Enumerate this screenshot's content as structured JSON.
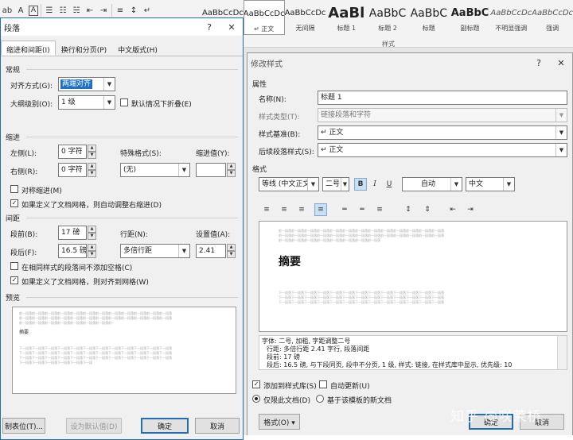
{
  "ribbon": {
    "styles": [
      {
        "preview": "AaBbCcDc",
        "name": "",
        "size": 10,
        "weight": "normal",
        "italic": false,
        "selected": false
      },
      {
        "preview": "AaBbCcDc",
        "name": "↵ 正文",
        "size": 10,
        "weight": "normal",
        "italic": false,
        "selected": true
      },
      {
        "preview": "AaBbCcDc",
        "name": "无间隔",
        "size": 10,
        "weight": "normal",
        "italic": false,
        "selected": false
      },
      {
        "preview": "AaBl",
        "name": "标题 1",
        "size": 18,
        "weight": "bold",
        "italic": false,
        "selected": false
      },
      {
        "preview": "AaBbC",
        "name": "标题 2",
        "size": 14,
        "weight": "normal",
        "italic": false,
        "selected": false
      },
      {
        "preview": "AaBbC",
        "name": "标题",
        "size": 14,
        "weight": "normal",
        "italic": false,
        "selected": false
      },
      {
        "preview": "AaBbC",
        "name": "副标题",
        "size": 13,
        "weight": "bold",
        "italic": false,
        "selected": false
      },
      {
        "preview": "AaBbCcDc",
        "name": "不明显强调",
        "size": 10,
        "weight": "normal",
        "italic": true,
        "selected": false
      },
      {
        "preview": "AaBbCcDc",
        "name": "强调",
        "size": 10,
        "weight": "normal",
        "italic": true,
        "selected": false
      }
    ],
    "styles_group_label": "样式"
  },
  "para": {
    "title": "段落",
    "help": "?",
    "close": "✕",
    "tabs": [
      "缩进和间距(I)",
      "换行和分页(P)",
      "中文版式(H)"
    ],
    "general_heading": "常规",
    "alignment_label": "对齐方式(G):",
    "alignment_value": "两端对齐",
    "outline_label": "大纲级别(O):",
    "outline_value": "1 级",
    "collapse_label": "默认情况下折叠(E)",
    "indent_heading": "缩进",
    "left_label": "左侧(L):",
    "left_value": "0 字符",
    "right_label": "右侧(R):",
    "right_value": "0 字符",
    "special_label": "特殊格式(S):",
    "special_value": "(无)",
    "indent_by_label": "缩进值(Y):",
    "indent_by_value": "",
    "mirror_label": "对称缩进(M)",
    "auto_right_label": "如果定义了文档网格，则自动调整右缩进(D)",
    "spacing_heading": "间距",
    "before_label": "段前(B):",
    "before_value": "17 磅",
    "after_label": "段后(F):",
    "after_value": "16.5 磅",
    "line_label": "行距(N):",
    "line_value": "多倍行距",
    "at_label": "设置值(A):",
    "at_value": "2.41",
    "no_space_label": "在相同样式的段落间不添加空格(C)",
    "snap_grid_label": "如果定义了文档网格，则对齐到网格(W)",
    "preview_heading": "预览",
    "preview_line": "前一段落前一段落前一段落前一段落前一段落前一段落前一段落前一段落前一段落前一段落前一段落前一段落",
    "preview_next": "下一段落下一段落下一段落下一段落下一段落下一段落下一段落下一段落下一段落下一段落下一段落下一段落",
    "preview_sample": "摘要",
    "tabs_button": "制表位(T)...",
    "default_button": "设为默认值(D)",
    "ok_button": "确定",
    "cancel_button": "取消"
  },
  "modify": {
    "title": "修改样式",
    "help": "?",
    "close": "✕",
    "props_heading": "属性",
    "name_label": "名称(N):",
    "name_value": "标题 1",
    "type_label": "样式类型(T):",
    "type_value": "链接段落和字符",
    "based_label": "样式基准(B):",
    "based_value": "↵ 正文",
    "follow_label": "后续段落样式(S):",
    "follow_value": "↵ 正文",
    "format_heading": "格式",
    "font_value": "等线 (中文正文)",
    "size_value": "二号",
    "bold": "B",
    "italic": "I",
    "underline": "U",
    "color_value": "自动",
    "lang_value": "中文",
    "preview_prev": "前一段落前一段落前一段落前一段落前一段落前一段落前一段落前一段落前一段落前一段落前一段落前一段落前一段落",
    "preview_prev2": "前一段落前一段落前一段落前一段落前一段落前一段落前一段落前一段落前一段落前一段落前一段落前一段落前一段落",
    "preview_prev3": "前一段落前一段落前一段落前一段落前一段落前一段落前一段落前一段落",
    "preview_sample": "摘要",
    "preview_next": "下一段落下一段落下一段落下一段落下一段落下一段落下一段落下一段落下一段落下一段落下一段落下一段落下一段落",
    "desc_1": "字体: 二号, 加粗, 字距调整二号",
    "desc_2": "行距: 多倍行距 2.41 字行, 段落间距",
    "desc_3": "段前: 17 磅",
    "desc_4": "段后: 16.5 磅, 与下段同页, 段中不分页, 1 级, 样式: 链接, 在样式库中显示, 优先级: 10",
    "add_gallery_label": "添加到样式库(S)",
    "auto_update_label": "自动更新(U)",
    "only_doc_label": "仅限此文档(D)",
    "template_label": "基于该模板的新文档",
    "format_button": "格式(O) ▾",
    "ok_button": "确定",
    "cancel_button": "取消"
  },
  "watermark": "知乎 @咲茉桥"
}
